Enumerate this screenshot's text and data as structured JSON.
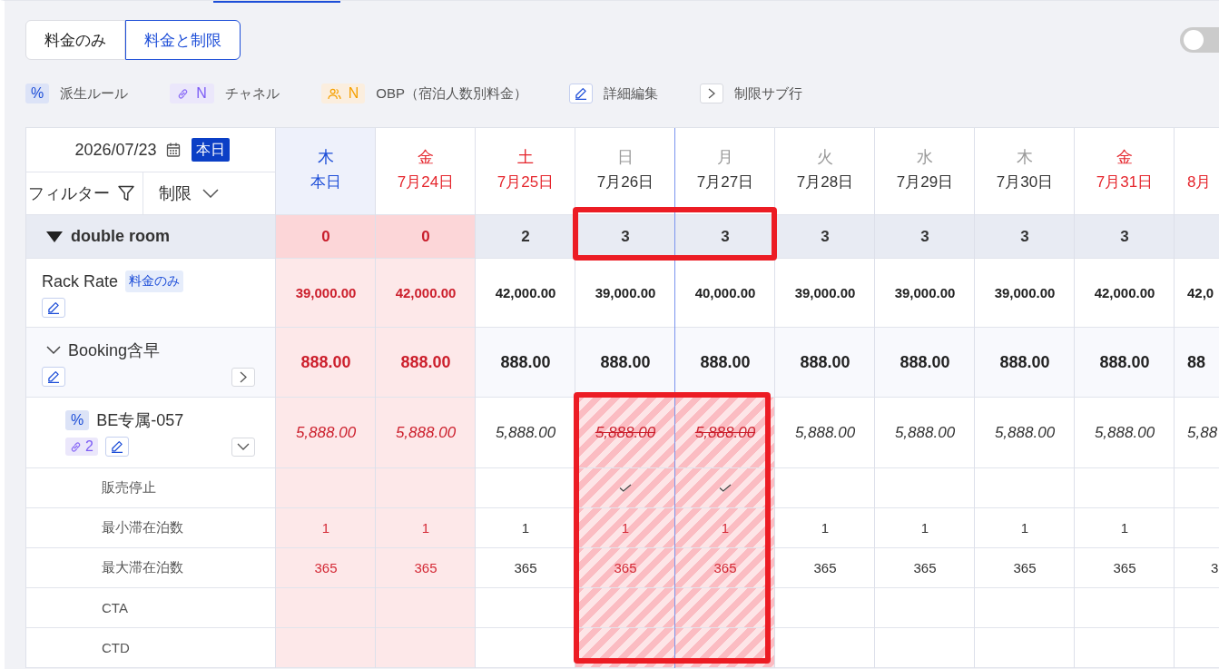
{
  "view_switch": [
    {
      "label": "料金のみ",
      "selected": false
    },
    {
      "label": "料金と制限",
      "selected": true
    }
  ],
  "display_toggle": {
    "on": false
  },
  "legend": [
    {
      "kind": "derived",
      "badge": "%",
      "label": "派生ルール"
    },
    {
      "kind": "channel",
      "badge": "N",
      "label": "チャネル"
    },
    {
      "kind": "obp",
      "badge": "N",
      "label": "OBP（宿泊人数別料金）"
    },
    {
      "kind": "edit",
      "label": "詳細編集"
    },
    {
      "kind": "restriction",
      "label": "制限サブ行"
    }
  ],
  "grid": {
    "date": "2026/07/23",
    "today_button": "本日",
    "filter_label": "フィルター",
    "restriction_select": "制限",
    "columns": [
      {
        "day": "木",
        "date": "本日",
        "today": true,
        "weekend": false,
        "week_start": false
      },
      {
        "day": "金",
        "date": "7月24日",
        "today": false,
        "weekend": true,
        "week_start": false
      },
      {
        "day": "土",
        "date": "7月25日",
        "today": false,
        "weekend": true,
        "week_start": false
      },
      {
        "day": "日",
        "date": "7月26日",
        "today": false,
        "weekend": false,
        "week_start": false
      },
      {
        "day": "月",
        "date": "7月27日",
        "today": false,
        "weekend": false,
        "week_start": true
      },
      {
        "day": "火",
        "date": "7月28日",
        "today": false,
        "weekend": false,
        "week_start": false
      },
      {
        "day": "水",
        "date": "7月29日",
        "today": false,
        "weekend": false,
        "week_start": false
      },
      {
        "day": "木",
        "date": "7月30日",
        "today": false,
        "weekend": false,
        "week_start": false
      },
      {
        "day": "金",
        "date": "7月31日",
        "today": false,
        "weekend": true,
        "week_start": false
      },
      {
        "date": "8月",
        "today": false,
        "weekend": true,
        "week_start": false
      }
    ],
    "room": {
      "name": "double room",
      "expanded": true,
      "availability": [
        {
          "value": "0",
          "sold_out": true
        },
        {
          "value": "0",
          "sold_out": true
        },
        {
          "value": "2",
          "sold_out": false
        },
        {
          "value": "3",
          "sold_out": false
        },
        {
          "value": "3",
          "sold_out": false
        },
        {
          "value": "3",
          "sold_out": false
        },
        {
          "value": "3",
          "sold_out": false
        },
        {
          "value": "3",
          "sold_out": false
        },
        {
          "value": "3",
          "sold_out": false
        }
      ],
      "rate_plans": [
        {
          "kind": "base",
          "name": "Rack Rate",
          "badge": "料金のみ",
          "values": [
            "39,000.00",
            "42,000.00",
            "42,000.00",
            "39,000.00",
            "40,000.00",
            "39,000.00",
            "39,000.00",
            "39,000.00",
            "42,000.00",
            "42,0"
          ]
        },
        {
          "kind": "parent",
          "name": "Booking含早",
          "expanded": true,
          "restrictions_expanded": false,
          "values": [
            "888.00",
            "888.00",
            "888.00",
            "888.00",
            "888.00",
            "888.00",
            "888.00",
            "888.00",
            "888.00",
            "88"
          ],
          "children": [
            {
              "kind": "derived",
              "name": "BE专属-057",
              "derived_mark": "%",
              "channel_count": "2",
              "restrictions_expanded": true,
              "values": [
                "5,888.00",
                "5,888.00",
                "5,888.00",
                "5,888.00",
                "5,888.00",
                "5,888.00",
                "5,888.00",
                "5,888.00",
                "5,888.00",
                "5,88"
              ],
              "restrictions": [
                {
                  "kind": "stop_sell",
                  "label": "販売停止",
                  "values": [
                    false,
                    false,
                    false,
                    true,
                    true,
                    false,
                    false,
                    false,
                    false
                  ]
                },
                {
                  "kind": "number",
                  "label": "最小滞在泊数",
                  "values": [
                    "1",
                    "1",
                    "1",
                    "1",
                    "1",
                    "1",
                    "1",
                    "1",
                    "1"
                  ]
                },
                {
                  "kind": "number",
                  "label": "最大滞在泊数",
                  "values": [
                    "365",
                    "365",
                    "365",
                    "365",
                    "365",
                    "365",
                    "365",
                    "365",
                    "365",
                    "3"
                  ]
                },
                {
                  "kind": "flag",
                  "label": "CTA"
                },
                {
                  "kind": "flag",
                  "label": "CTD"
                }
              ]
            }
          ]
        }
      ]
    }
  }
}
